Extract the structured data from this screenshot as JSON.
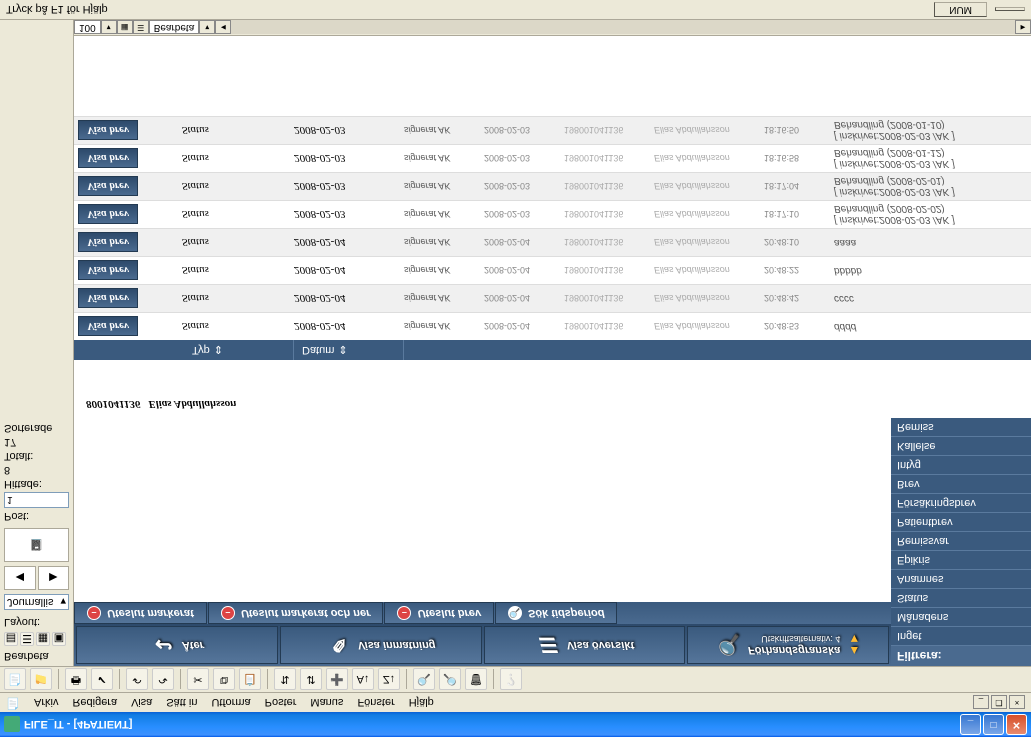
{
  "window": {
    "title": "FILE_IT - [4PATIENT]"
  },
  "menu": {
    "arkiv": "Arkiv",
    "redigera": "Redigera",
    "visa": "Visa",
    "satt_in": "Sätt in",
    "utforma": "Utforma",
    "poster": "Poster",
    "manus": "Manus",
    "fonster": "Fönster",
    "hjalp": "Hjälp"
  },
  "left": {
    "layout_label": "Layout:",
    "bearbeta_label": "Bearbeta",
    "journallis": "Journallis",
    "post_label": "Post:",
    "post_value": "1",
    "hittade_label": "Hittade:",
    "hittade_value": "8",
    "totalt_label": "Totalt:",
    "totalt_value": "17",
    "sorterade_label": "Sorterade"
  },
  "bigbuttons": {
    "ater": "Åter",
    "visa_inmatning": "Visa inmatning",
    "visa_oversikt": "Visa översikt",
    "forhandsgranska": "Förhandsgranska",
    "forhand_sub": "Utskriftsalternativ: 4"
  },
  "filter": {
    "header": "Filtrera:",
    "items": [
      "Inget",
      "Månadens",
      "Status",
      "Anamnes",
      "Epikris",
      "Remissvar",
      "Patientbrev",
      "Försäkringsbrev",
      "Brev",
      "Intyg",
      "Kallelse",
      "Remiss"
    ]
  },
  "subbuttons": {
    "uteslut_markerat": "Uteslut markerat",
    "uteslut_markerat_ner": "Uteslut markerat och ner",
    "uteslut_brev": "Uteslut brev",
    "sok_tidsperiod": "Sök tidsperiod"
  },
  "patient": {
    "id": "8001041136",
    "name": "Elias Abdullahsson"
  },
  "grid": {
    "col_typ": "Typ",
    "col_datum": "Datum",
    "visa_brev": "Visa brev",
    "rows": [
      {
        "typ": "Status",
        "datum": "2008-02-04",
        "sig": "signerat AK",
        "sigd": "2008-02-04",
        "pid": "198001041136",
        "pnm": "Elias Abdullahsson",
        "tm": "20:48:53",
        "desc": "dddd"
      },
      {
        "typ": "Status",
        "datum": "2008-02-04",
        "sig": "signerat AK",
        "sigd": "2008-02-04",
        "pid": "198001041136",
        "pnm": "Elias Abdullahsson",
        "tm": "20:48:42",
        "desc": "cccc"
      },
      {
        "typ": "Status",
        "datum": "2008-02-04",
        "sig": "signerat AK",
        "sigd": "2008-02-04",
        "pid": "198001041136",
        "pnm": "Elias Abdullahsson",
        "tm": "20:48:22",
        "desc": "bbbbb"
      },
      {
        "typ": "Status",
        "datum": "2008-02-04",
        "sig": "signerat AK",
        "sigd": "2008-02-04",
        "pid": "198001041136",
        "pnm": "Elias Abdullahsson",
        "tm": "20:48:10",
        "desc": "aaaa"
      },
      {
        "typ": "Status",
        "datum": "2008-02-03",
        "sig": "signerat AK",
        "sigd": "2008-02-03",
        "pid": "198001041136",
        "pnm": "Elias Abdullahsson",
        "tm": "18:17:10",
        "desc": "[ inskrivet:2008-02-03 /AK ]\nBehandling (2008-02-02)"
      },
      {
        "typ": "Status",
        "datum": "2008-02-03",
        "sig": "signerat AK",
        "sigd": "2008-02-03",
        "pid": "198001041136",
        "pnm": "Elias Abdullahsson",
        "tm": "18:17:04",
        "desc": "[ inskrivet:2008-02-03 /AK ]\nBehandling (2008-02-01)"
      },
      {
        "typ": "Status",
        "datum": "2008-02-03",
        "sig": "signerat AK",
        "sigd": "2008-02-03",
        "pid": "198001041136",
        "pnm": "Elias Abdullahsson",
        "tm": "18:16:58",
        "desc": "[ inskrivet:2008-02-03 /AK ]\nBehandling (2008-01-12)"
      },
      {
        "typ": "Status",
        "datum": "2008-02-03",
        "sig": "signerat AK",
        "sigd": "2008-02-03",
        "pid": "198001041136",
        "pnm": "Elias Abdullahsson",
        "tm": "18:16:50",
        "desc": "[ inskrivet:2008-02-03 /AK ]\nBehandling (2008-01-10)"
      }
    ]
  },
  "bottom": {
    "mode": "Bearbeta",
    "zoom": "100"
  },
  "status": {
    "help": "Tryck på F1 för Hjälp",
    "num": "NUM"
  }
}
